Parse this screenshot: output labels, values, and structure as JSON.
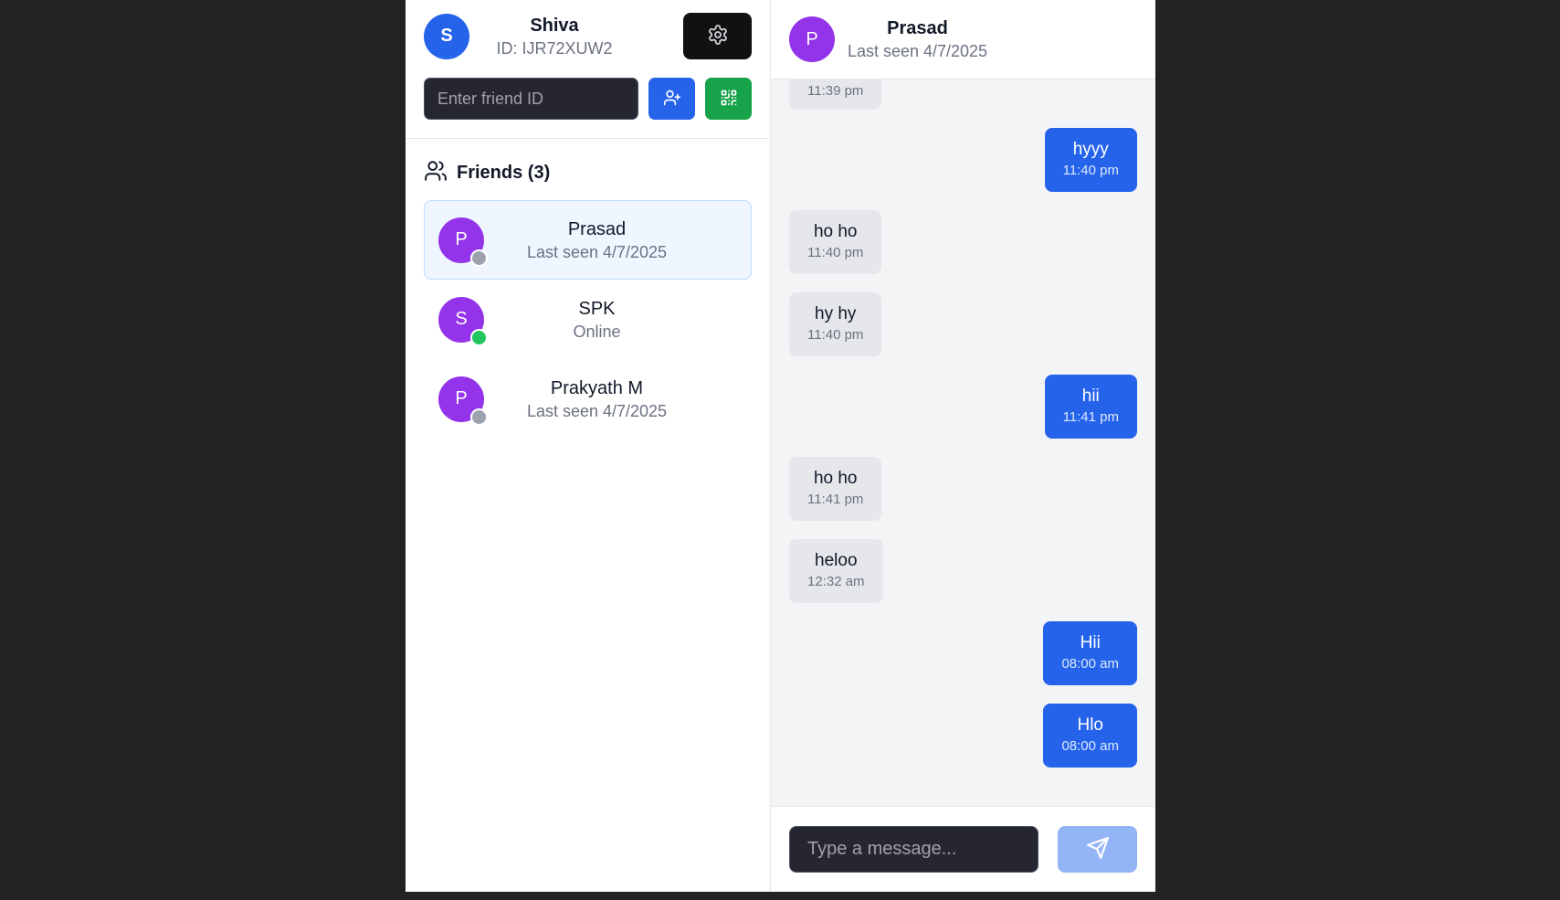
{
  "colors": {
    "primary": "#2563eb",
    "success": "#16a34a",
    "friend_avatar": "#9333ea",
    "online": "#22c55e",
    "offline": "#9ca3af"
  },
  "profile": {
    "initial": "S",
    "name": "Shiva",
    "id_text": "ID: IJR72XUW2"
  },
  "add_friend": {
    "placeholder": "Enter friend ID",
    "value": ""
  },
  "friends": {
    "heading": "Friends (3)",
    "items": [
      {
        "initial": "P",
        "name": "Prasad",
        "status": "Last seen 4/7/2025",
        "online": false,
        "active": true
      },
      {
        "initial": "S",
        "name": "SPK",
        "status": "Online",
        "online": true,
        "active": false
      },
      {
        "initial": "P",
        "name": "Prakyath M",
        "status": "Last seen 4/7/2025",
        "online": false,
        "active": false
      }
    ]
  },
  "chat": {
    "initial": "P",
    "name": "Prasad",
    "status": "Last seen 4/7/2025",
    "messages": [
      {
        "dir": "in",
        "text": "",
        "time": "11:39 pm"
      },
      {
        "dir": "out",
        "text": "hyyy",
        "time": "11:40 pm"
      },
      {
        "dir": "in",
        "text": "ho ho",
        "time": "11:40 pm"
      },
      {
        "dir": "in",
        "text": "hy hy",
        "time": "11:40 pm"
      },
      {
        "dir": "out",
        "text": "hii",
        "time": "11:41 pm"
      },
      {
        "dir": "in",
        "text": "ho ho",
        "time": "11:41 pm"
      },
      {
        "dir": "in",
        "text": "heloo",
        "time": "12:32 am"
      },
      {
        "dir": "out",
        "text": "Hii",
        "time": "08:00 am"
      },
      {
        "dir": "out",
        "text": "Hlo",
        "time": "08:00 am"
      }
    ]
  },
  "composer": {
    "placeholder": "Type a message...",
    "value": ""
  }
}
